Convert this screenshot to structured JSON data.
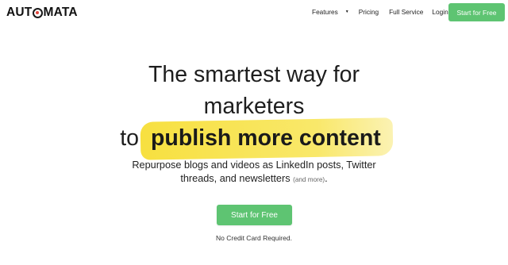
{
  "brand": {
    "logo_before": "AUT",
    "logo_o": "O",
    "logo_after": "MATA",
    "accent": "#e0443a"
  },
  "nav": {
    "features": "Features",
    "features_caret": "▼",
    "pricing": "Pricing",
    "full_service": "Full Service",
    "login": "Login",
    "cta": "Start for Free"
  },
  "hero": {
    "line1": "The smartest way for",
    "line2": "marketers",
    "line3_prefix": "to",
    "line3_highlight": "publish more content",
    "sub_line1": "Repurpose blogs and videos as LinkedIn posts, Twitter",
    "sub_line2": "threads, and newsletters",
    "sub_small": "(and more)",
    "sub_end": ".",
    "cta": "Start for Free",
    "note": "No Credit Card Required."
  },
  "colors": {
    "cta_green": "#5ec472",
    "highlight_yellow": "#f7e040"
  }
}
